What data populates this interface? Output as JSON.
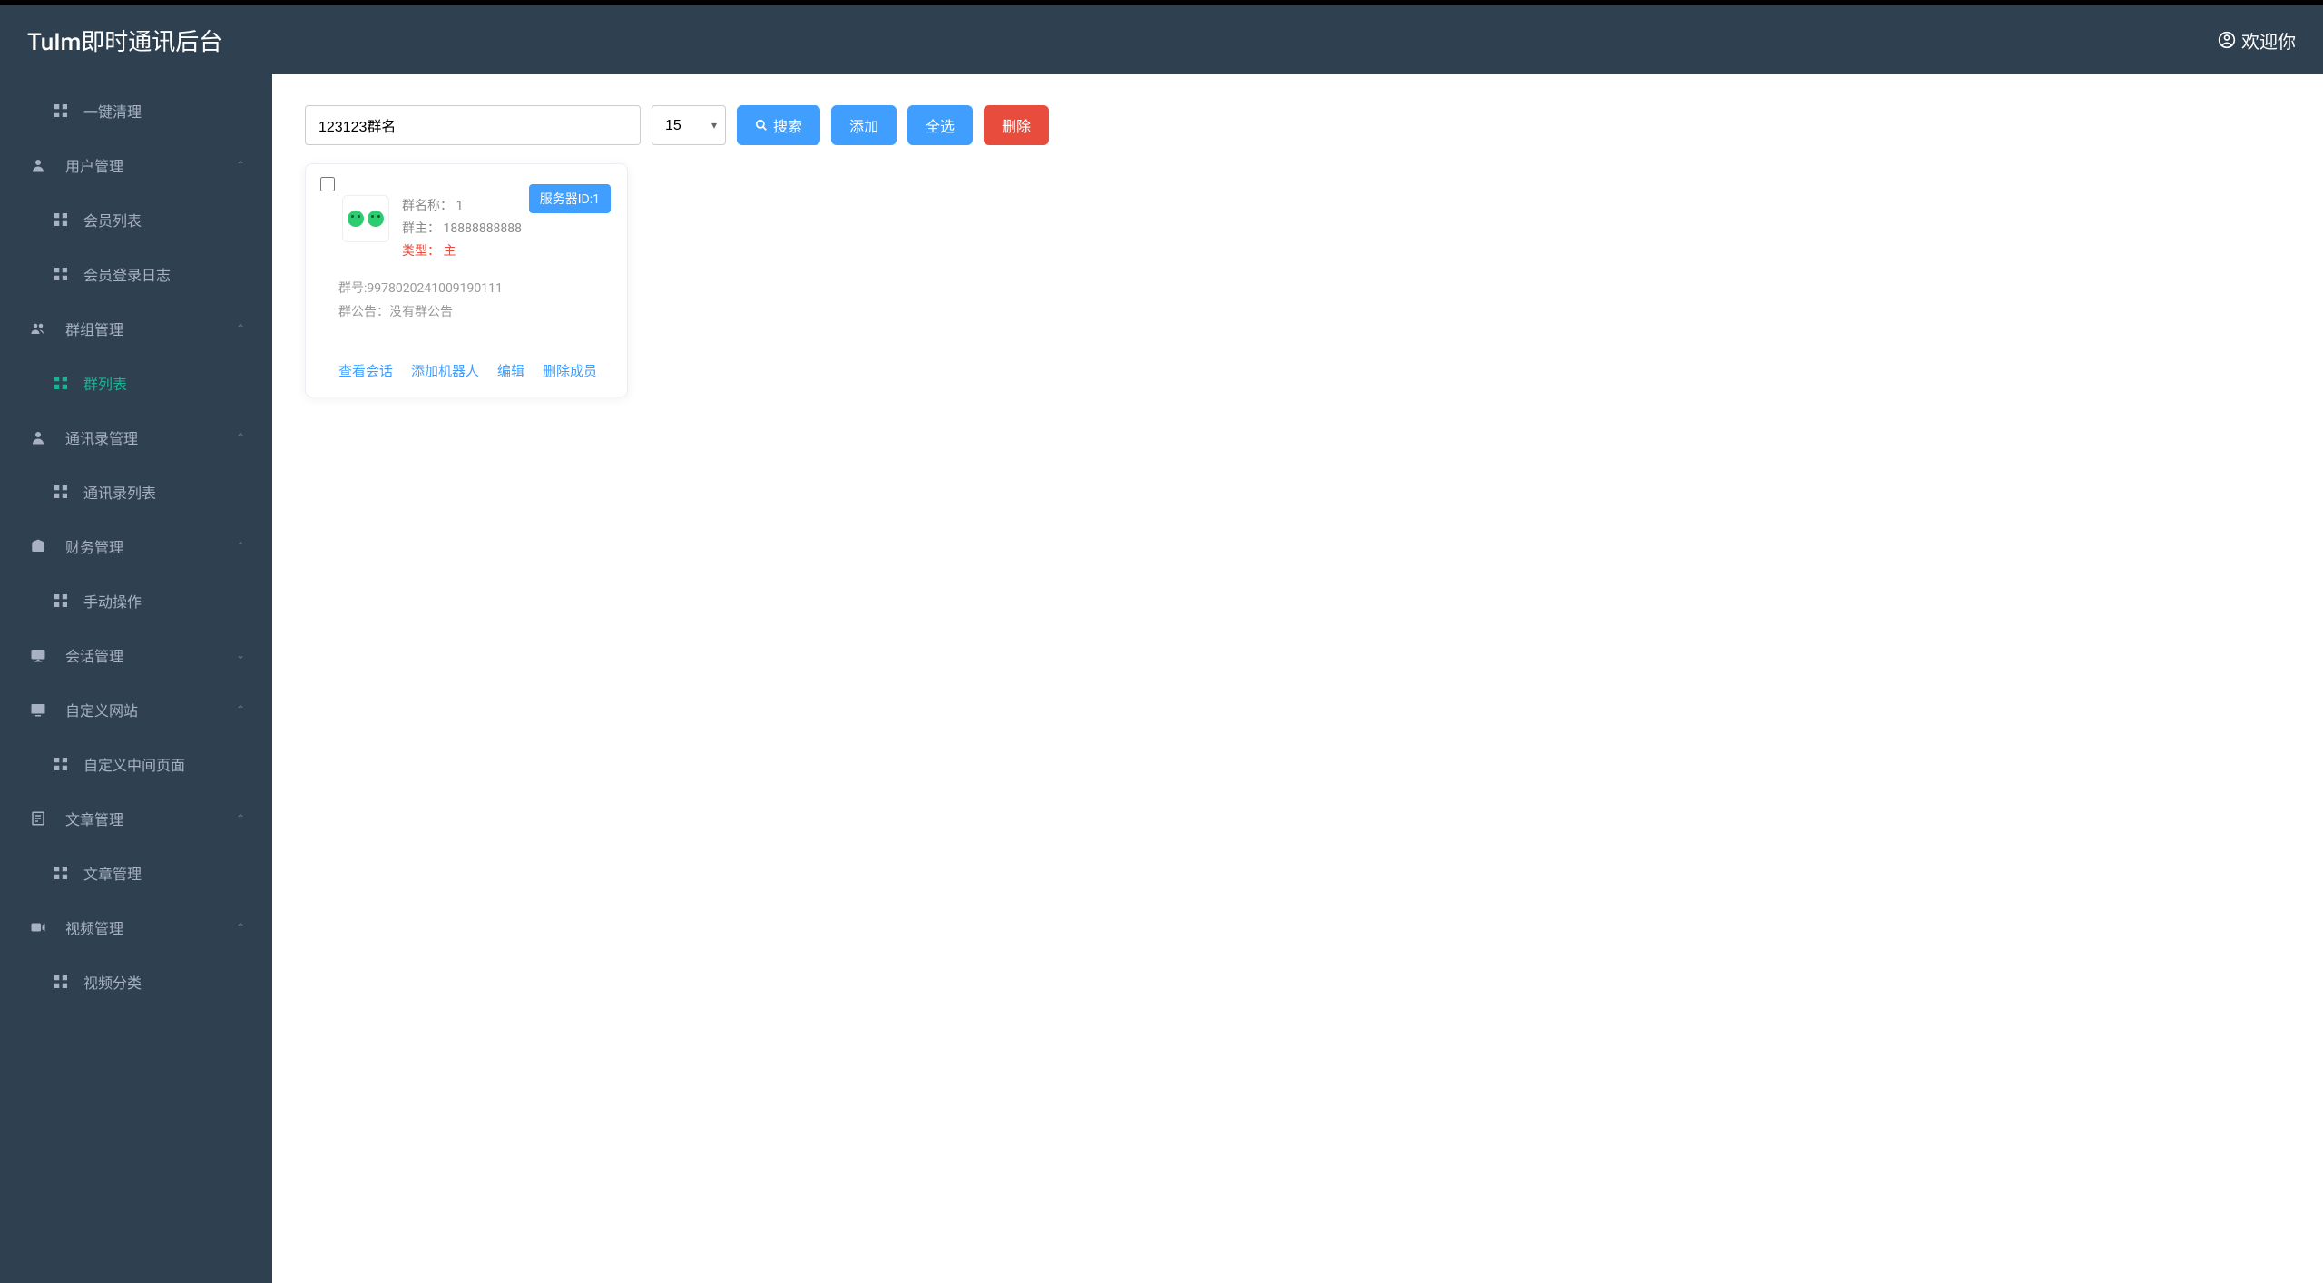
{
  "header": {
    "title": "TuIm即时通讯后台",
    "welcome": "欢迎你"
  },
  "sidebar": {
    "items": [
      {
        "type": "sub",
        "label": "一键清理",
        "name": "cleanup"
      },
      {
        "type": "top",
        "label": "用户管理",
        "name": "user-mgmt",
        "chevron": "up"
      },
      {
        "type": "sub",
        "label": "会员列表",
        "name": "member-list"
      },
      {
        "type": "sub",
        "label": "会员登录日志",
        "name": "member-login-log"
      },
      {
        "type": "top",
        "label": "群组管理",
        "name": "group-mgmt",
        "chevron": "up"
      },
      {
        "type": "sub",
        "label": "群列表",
        "name": "group-list",
        "active": true
      },
      {
        "type": "top",
        "label": "通讯录管理",
        "name": "contacts-mgmt",
        "chevron": "up"
      },
      {
        "type": "sub",
        "label": "通讯录列表",
        "name": "contacts-list"
      },
      {
        "type": "top",
        "label": "财务管理",
        "name": "finance-mgmt",
        "chevron": "up"
      },
      {
        "type": "sub",
        "label": "手动操作",
        "name": "manual-op"
      },
      {
        "type": "top",
        "label": "会话管理",
        "name": "session-mgmt",
        "chevron": "down"
      },
      {
        "type": "top",
        "label": "自定义网站",
        "name": "custom-site",
        "chevron": "up"
      },
      {
        "type": "sub",
        "label": "自定义中间页面",
        "name": "custom-middle-page"
      },
      {
        "type": "top",
        "label": "文章管理",
        "name": "article-mgmt",
        "chevron": "up"
      },
      {
        "type": "sub",
        "label": "文章管理",
        "name": "article-mgmt-sub"
      },
      {
        "type": "top",
        "label": "视频管理",
        "name": "video-mgmt",
        "chevron": "up"
      },
      {
        "type": "sub",
        "label": "视频分类",
        "name": "video-category"
      }
    ]
  },
  "toolbar": {
    "search_value": "123123群名",
    "page_size": "15",
    "search_btn": "搜索",
    "add_btn": "添加",
    "select_all_btn": "全选",
    "delete_btn": "删除"
  },
  "card": {
    "server_badge": "服务器ID:1",
    "group_name_label": "群名称：",
    "group_name_value": "1",
    "owner_label": "群主：",
    "owner_value": "18888888888",
    "type_label": "类型：",
    "type_value": "主",
    "group_id_label": "群号:",
    "group_id_value": "9978020241009190111",
    "announcement_label": "群公告：",
    "announcement_value": "没有群公告",
    "actions": {
      "view_session": "查看会话",
      "add_robot": "添加机器人",
      "edit": "编辑",
      "remove_member": "删除成员"
    }
  }
}
